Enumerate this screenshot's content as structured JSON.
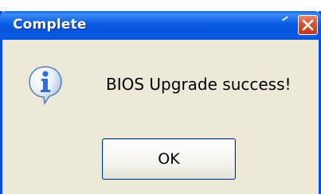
{
  "window": {
    "title": "Complete",
    "close_icon": "close-icon"
  },
  "dialog": {
    "icon": "info-icon",
    "message": "BIOS Upgrade success!",
    "ok_label": "OK"
  },
  "colors": {
    "titlebar": "#0a5ce5",
    "client_background": "#ece9d8",
    "close_button": "#d7502f",
    "info_icon": "#2f6fd6"
  }
}
